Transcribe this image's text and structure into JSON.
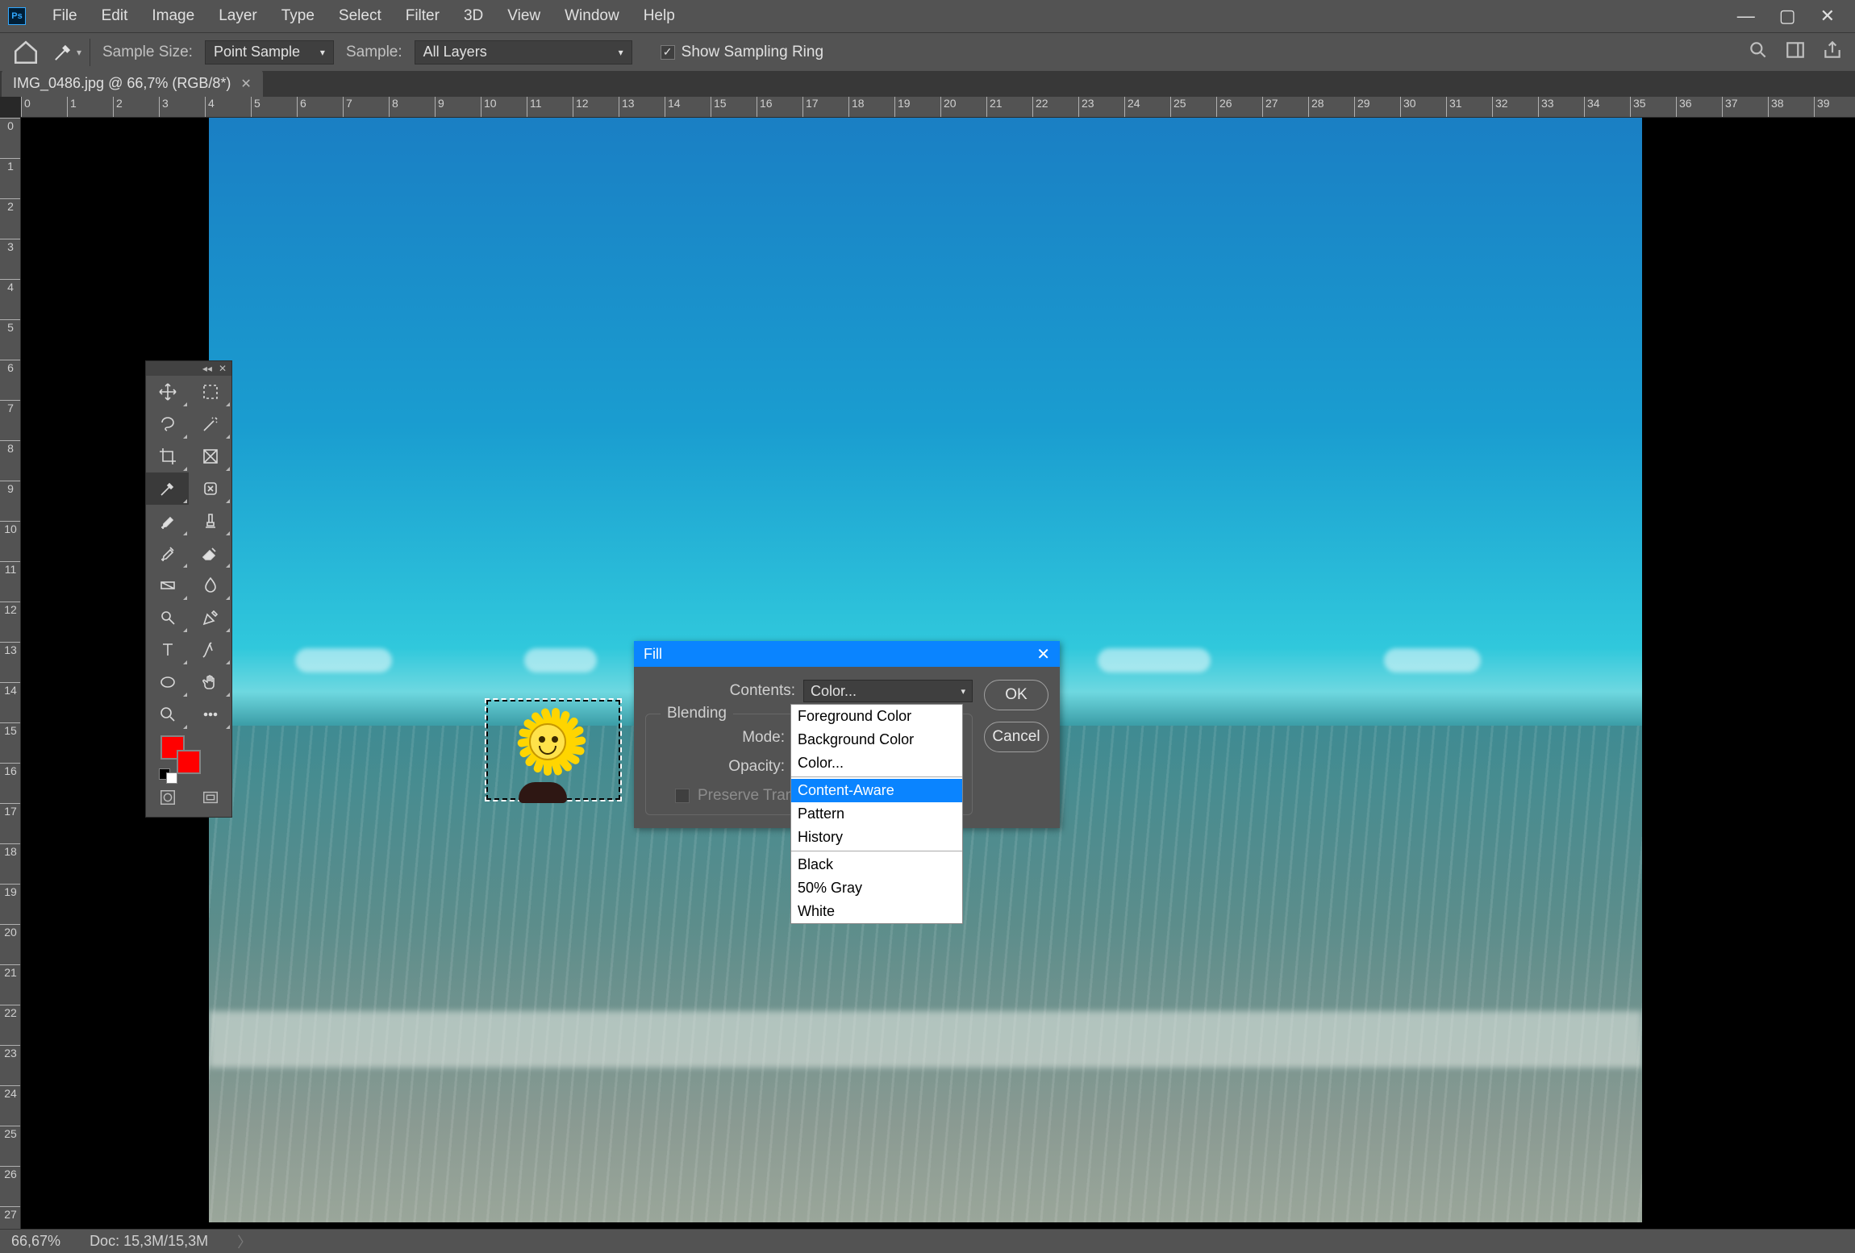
{
  "menu": {
    "items": [
      "File",
      "Edit",
      "Image",
      "Layer",
      "Type",
      "Select",
      "Filter",
      "3D",
      "View",
      "Window",
      "Help"
    ]
  },
  "options": {
    "sample_size_label": "Sample Size:",
    "sample_size_value": "Point Sample",
    "sample_label": "Sample:",
    "sample_value": "All Layers",
    "show_ring_label": "Show Sampling Ring"
  },
  "tab": {
    "title": "IMG_0486.jpg @ 66,7% (RGB/8*)"
  },
  "ruler_h": [
    0,
    1,
    2,
    3,
    4,
    5,
    6,
    7,
    8,
    9,
    10,
    11,
    12,
    13,
    14,
    15,
    16,
    17,
    18,
    19,
    20,
    21,
    22,
    23,
    24,
    25,
    26,
    27,
    28,
    29,
    30,
    31,
    32,
    33,
    34,
    35,
    36,
    37,
    38,
    39
  ],
  "ruler_v": [
    0,
    1,
    2,
    3,
    4,
    5,
    6,
    7,
    8,
    9,
    10,
    11,
    12,
    13,
    14,
    15,
    16,
    17,
    18,
    19,
    20,
    21,
    22,
    23,
    24,
    25,
    26,
    27
  ],
  "tools": [
    {
      "name": "move-tool"
    },
    {
      "name": "marquee-tool"
    },
    {
      "name": "lasso-tool"
    },
    {
      "name": "magic-wand-tool"
    },
    {
      "name": "crop-tool"
    },
    {
      "name": "frame-tool"
    },
    {
      "name": "eyedropper-tool",
      "active": true
    },
    {
      "name": "healing-brush-tool"
    },
    {
      "name": "brush-tool"
    },
    {
      "name": "stamp-tool"
    },
    {
      "name": "history-brush-tool"
    },
    {
      "name": "eraser-tool"
    },
    {
      "name": "gradient-tool"
    },
    {
      "name": "blur-tool"
    },
    {
      "name": "dodge-tool"
    },
    {
      "name": "pen-tool"
    },
    {
      "name": "type-tool"
    },
    {
      "name": "path-tool"
    },
    {
      "name": "shape-tool"
    },
    {
      "name": "hand-tool"
    },
    {
      "name": "zoom-tool"
    },
    {
      "name": "more-tool"
    }
  ],
  "swatch": {
    "fg": "#ff0000",
    "bg": "#ff0000"
  },
  "dialog": {
    "title": "Fill",
    "contents_label": "Contents:",
    "contents_value": "Color...",
    "blending_legend": "Blending",
    "mode_label": "Mode:",
    "opacity_label": "Opacity:",
    "preserve_label": "Preserve Transparency",
    "ok": "OK",
    "cancel": "Cancel"
  },
  "dropdown": {
    "groups": [
      [
        "Foreground Color",
        "Background Color",
        "Color..."
      ],
      [
        "Content-Aware",
        "Pattern",
        "History"
      ],
      [
        "Black",
        "50% Gray",
        "White"
      ]
    ],
    "highlighted": "Content-Aware"
  },
  "status": {
    "zoom": "66,67%",
    "doc": "Doc: 15,3M/15,3M"
  }
}
